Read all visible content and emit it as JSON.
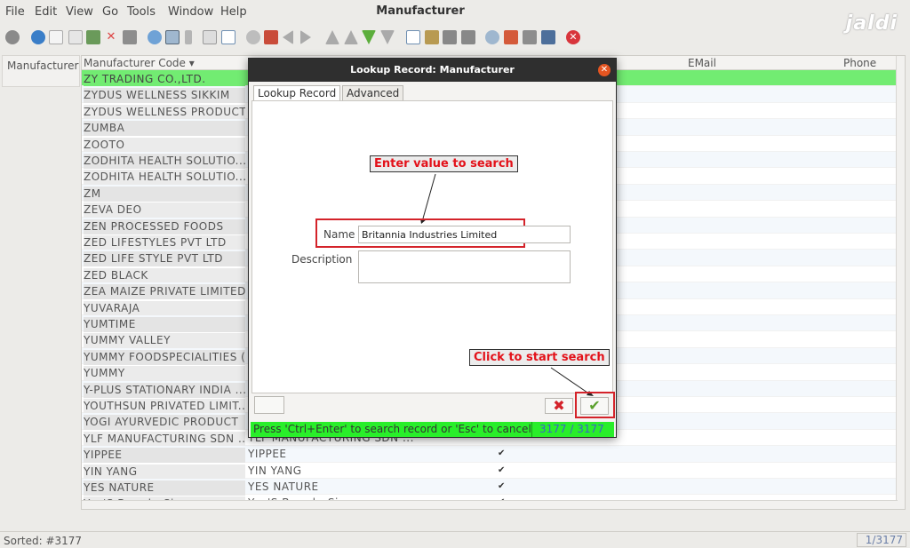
{
  "menu": [
    "File",
    "Edit",
    "View",
    "Go",
    "Tools",
    "Window",
    "Help"
  ],
  "window_title": "Manufacturer",
  "logo_text": "jaldi",
  "left_tab": "Manufacturer",
  "grid": {
    "headers": {
      "code": "Manufacturer Code",
      "email": "EMail",
      "phone": "Phone"
    },
    "rows": [
      {
        "code": "ZY TRADING CO.,LTD.",
        "name": "",
        "check": ""
      },
      {
        "code": "ZYDUS WELLNESS SIKKIM",
        "name": "",
        "check": ""
      },
      {
        "code": "ZYDUS WELLNESS PRODUCT...",
        "name": "",
        "check": ""
      },
      {
        "code": "ZUMBA",
        "name": "",
        "check": ""
      },
      {
        "code": "ZOOTO",
        "name": "",
        "check": ""
      },
      {
        "code": "ZODHITA HEALTH SOLUTIO...",
        "name": "",
        "check": ""
      },
      {
        "code": "ZODHITA HEALTH SOLUTIO...",
        "name": "",
        "check": ""
      },
      {
        "code": "ZM",
        "name": "",
        "check": ""
      },
      {
        "code": "ZEVA DEO",
        "name": "",
        "check": ""
      },
      {
        "code": "ZEN PROCESSED FOODS",
        "name": "",
        "check": ""
      },
      {
        "code": "ZED LIFESTYLES PVT LTD",
        "name": "",
        "check": ""
      },
      {
        "code": "ZED LIFE STYLE PVT LTD",
        "name": "",
        "check": ""
      },
      {
        "code": "ZED BLACK",
        "name": "",
        "check": ""
      },
      {
        "code": "ZEA MAIZE PRIVATE LIMITED",
        "name": "",
        "check": ""
      },
      {
        "code": "YUVARAJA",
        "name": "",
        "check": ""
      },
      {
        "code": "YUMTIME",
        "name": "",
        "check": ""
      },
      {
        "code": "YUMMY VALLEY",
        "name": "",
        "check": ""
      },
      {
        "code": "YUMMY FOODSPECIALITIES (...",
        "name": "",
        "check": ""
      },
      {
        "code": "YUMMY",
        "name": "",
        "check": ""
      },
      {
        "code": "Y-PLUS STATIONARY INDIA ...",
        "name": "",
        "check": ""
      },
      {
        "code": "YOUTHSUN PRIVATED LIMIT...",
        "name": "",
        "check": ""
      },
      {
        "code": "YOGI AYURVEDIC PRODUCT",
        "name": "",
        "check": ""
      },
      {
        "code": "YLF MANUFACTURING SDN ...",
        "name": "YLF MANUFACTURING SDN ...",
        "check": ""
      },
      {
        "code": "YIPPEE",
        "name": "YIPPEE",
        "check": "✔"
      },
      {
        "code": "YIN YANG",
        "name": "YIN YANG",
        "check": "✔"
      },
      {
        "code": "YES NATURE",
        "name": "YES NATURE",
        "check": "✔"
      },
      {
        "code": "Yeo'S Brand - Singapore",
        "name": "Yeo'S Brand - Singapore",
        "check": "✔"
      }
    ]
  },
  "status": {
    "left": "Sorted: #3177",
    "right": "1/3177"
  },
  "dialog": {
    "title": "Lookup Record: Manufacturer",
    "close_icon": "✕",
    "tabs": [
      "Lookup Record",
      "Advanced"
    ],
    "name_label": "Name",
    "name_value": "Britannia Industries Limited",
    "description_label": "Description",
    "callout_enter": "Enter value to search",
    "callout_click": "Click to start search",
    "cancel_icon": "✖",
    "ok_icon": "✔",
    "status_msg": "Press 'Ctrl+Enter' to search record or 'Esc' to cancel",
    "status_count": "3177 / 3177"
  },
  "colors": {
    "selected_row": "#72ec72",
    "status_green": "#29ee2a",
    "callout_red": "#e3121a",
    "close_orange": "#e55521"
  }
}
